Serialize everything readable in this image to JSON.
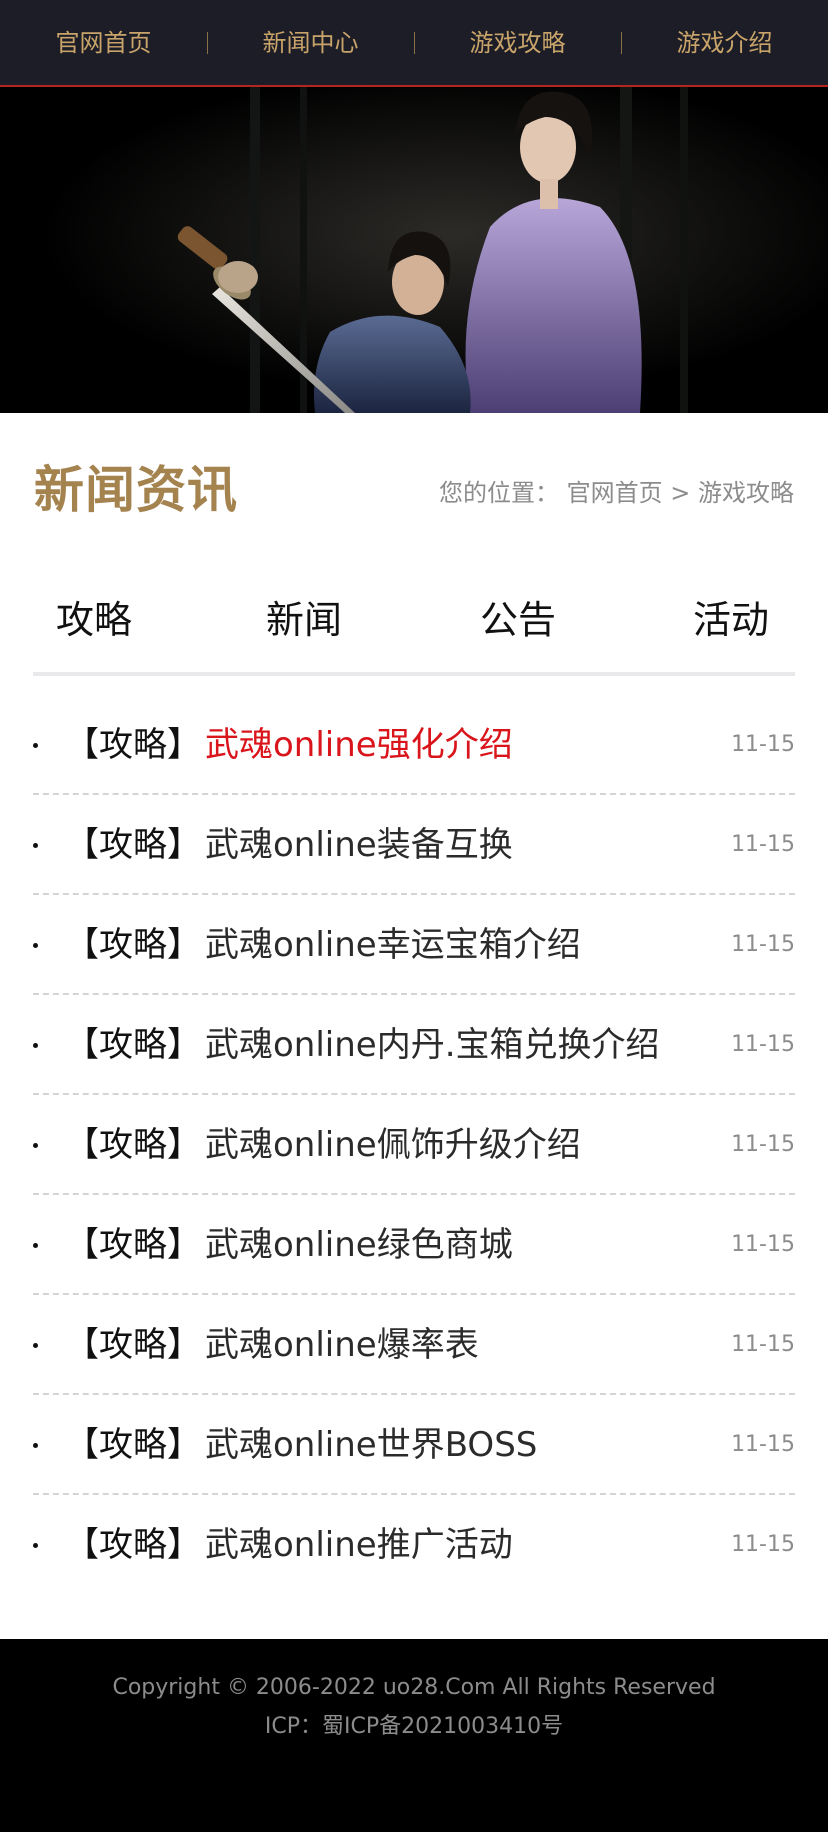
{
  "nav": {
    "items": [
      {
        "label": "官网首页"
      },
      {
        "label": "新闻中心"
      },
      {
        "label": "游戏攻略"
      },
      {
        "label": "游戏介绍"
      }
    ]
  },
  "section": {
    "title": "新闻资讯"
  },
  "breadcrumb": {
    "prefix": "您的位置：",
    "home": "官网首页",
    "separator": ">",
    "current": "游戏攻略"
  },
  "tabs": [
    {
      "label": "攻略"
    },
    {
      "label": "新闻"
    },
    {
      "label": "公告"
    },
    {
      "label": "活动"
    }
  ],
  "news": [
    {
      "category": "【攻略】",
      "title": "武魂online强化介绍",
      "date": "11-15",
      "active": true
    },
    {
      "category": "【攻略】",
      "title": "武魂online装备互换",
      "date": "11-15"
    },
    {
      "category": "【攻略】",
      "title": "武魂online幸运宝箱介绍",
      "date": "11-15"
    },
    {
      "category": "【攻略】",
      "title": "武魂online内丹.宝箱兑换介绍",
      "date": "11-15"
    },
    {
      "category": "【攻略】",
      "title": "武魂online佩饰升级介绍",
      "date": "11-15"
    },
    {
      "category": "【攻略】",
      "title": "武魂online绿色商城",
      "date": "11-15"
    },
    {
      "category": "【攻略】",
      "title": "武魂online爆率表",
      "date": "11-15"
    },
    {
      "category": "【攻略】",
      "title": "武魂online世界BOSS",
      "date": "11-15"
    },
    {
      "category": "【攻略】",
      "title": "武魂online推广活动",
      "date": "11-15"
    }
  ],
  "footer": {
    "copyright": "Copyright © 2006-2022 uo28.Com All Rights Reserved",
    "icp": "ICP：蜀ICP备2021003410号"
  },
  "colors": {
    "nav_bg": "#1c1d26",
    "nav_text": "#c9a46a",
    "nav_border": "#b3261e",
    "title_gold": "#a4834f",
    "active_red": "#d9141b",
    "footer_bg": "#000000"
  }
}
